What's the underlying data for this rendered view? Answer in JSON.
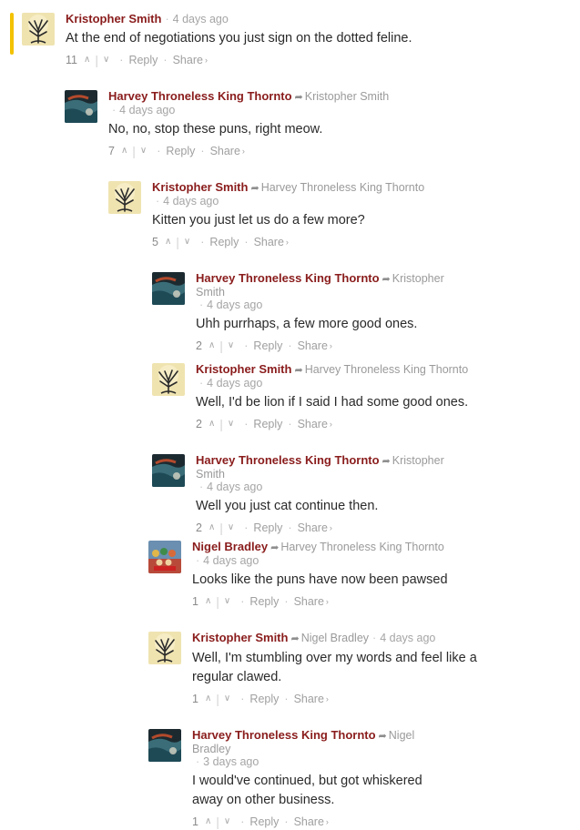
{
  "comments": [
    {
      "author": "Kristopher Smith",
      "reply_to": "",
      "time": "4 days ago",
      "text": "At the end of negotiations you just sign on the dotted feline.",
      "votes": "11",
      "avatar": "tree",
      "reply": "Reply",
      "share": "Share"
    },
    {
      "author": "Harvey Throneless King Thornto",
      "reply_to": "Kristopher Smith",
      "time": "4 days ago",
      "text": "No, no, stop these puns, right meow.",
      "votes": "7",
      "avatar": "painting",
      "reply": "Reply",
      "share": "Share"
    },
    {
      "author": "Kristopher Smith",
      "reply_to": "Harvey Throneless King Thornto",
      "time": "4 days ago",
      "text": "Kitten you just let us do a few more?",
      "votes": "5",
      "avatar": "tree",
      "reply": "Reply",
      "share": "Share"
    },
    {
      "author": "Harvey Throneless King Thornto",
      "reply_to": "Kristopher Smith",
      "time": "4 days ago",
      "text": "Uhh purrhaps, a few more good ones.",
      "votes": "2",
      "avatar": "painting",
      "reply": "Reply",
      "share": "Share"
    },
    {
      "author": "Kristopher Smith",
      "reply_to": "Harvey Throneless King Thornto",
      "time": "4 days ago",
      "text": "Well, I'd be lion if I said I had some good ones.",
      "votes": "2",
      "avatar": "tree",
      "reply": "Reply",
      "share": "Share"
    },
    {
      "author": "Harvey Throneless King Thornto",
      "reply_to": "Kristopher Smith",
      "time": "4 days ago",
      "text": "Well you just cat continue then.",
      "votes": "2",
      "avatar": "painting",
      "reply": "Reply",
      "share": "Share"
    },
    {
      "author": "Nigel Bradley",
      "reply_to": "Harvey Throneless King Thornto",
      "time": "4 days ago",
      "text": "Looks like the puns have now been pawsed",
      "votes": "1",
      "avatar": "album",
      "reply": "Reply",
      "share": "Share"
    },
    {
      "author": "Kristopher Smith",
      "reply_to": "Nigel Bradley",
      "time": "4 days ago",
      "text": "Well, I'm stumbling over my words and feel like a regular clawed.",
      "votes": "1",
      "avatar": "tree",
      "reply": "Reply",
      "share": "Share"
    },
    {
      "author": "Harvey Throneless King Thornto",
      "reply_to": "Nigel Bradley",
      "time": "3 days ago",
      "text": "I would've continued, but got whiskered away on other business.",
      "votes": "1",
      "avatar": "painting",
      "reply": "Reply",
      "share": "Share"
    }
  ],
  "icons": {
    "upvote": "chevron-up-icon",
    "downvote": "chevron-down-icon",
    "reply_arrow": "reply-arrow-icon",
    "share_chevron": "chevron-right-icon"
  },
  "colors": {
    "author": "#8a1c1c",
    "highlight": "#f3c200",
    "meta": "#a5a5a5",
    "text": "#2a2a2a"
  }
}
